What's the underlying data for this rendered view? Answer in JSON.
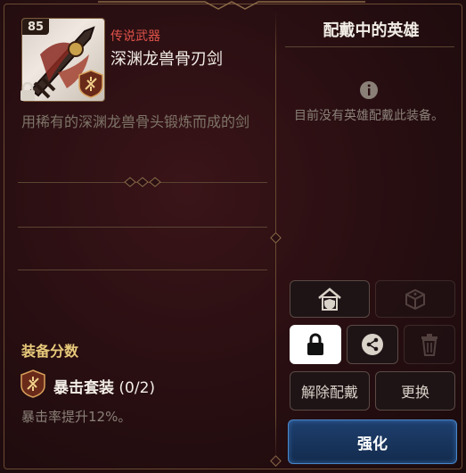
{
  "item": {
    "level": "85",
    "rarity": "传说武器",
    "name": "深渊龙兽骨刃剑",
    "description": "用稀有的深渊龙兽骨头锻炼而成的剑"
  },
  "score": {
    "label": "装备分数"
  },
  "set": {
    "name": "暴击套装",
    "progress": "(0/2)",
    "effect": "暴击率提升12%。"
  },
  "equipped": {
    "title": "配戴中的英雄",
    "empty_text": "目前没有英雄配戴此装备。"
  },
  "buttons": {
    "unequip": "解除配戴",
    "replace": "更换",
    "enhance": "强化"
  },
  "colors": {
    "rarity": "#e0524a",
    "score_label": "#e8c97a",
    "primary_border": "#4a86c8"
  },
  "icons": {
    "item": "sword-icon",
    "lock_small": "lock-icon",
    "set": "crit-set-icon",
    "info": "info-icon",
    "hero_guard": "house-shield-icon",
    "random": "dice-icon",
    "lock_toggle": "lock-icon",
    "share": "share-icon",
    "delete": "trash-icon"
  }
}
